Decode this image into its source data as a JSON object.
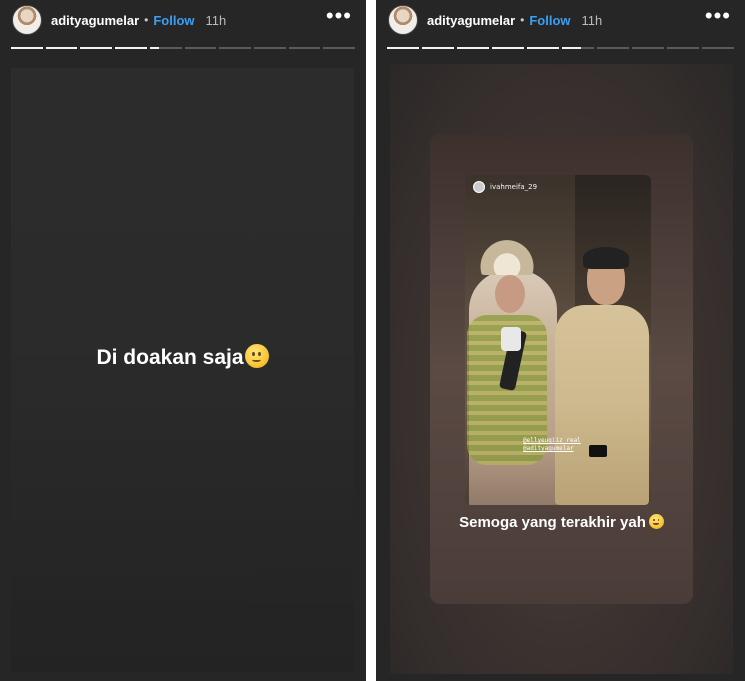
{
  "stories": [
    {
      "header": {
        "username": "adityagumelar",
        "follow_label": "Follow",
        "time": "11h",
        "more_glyph": "•••",
        "avatar_icon": "profile-avatar"
      },
      "progress": {
        "segments": 10,
        "completed": 4,
        "current_progress": 0.3
      },
      "caption": "Di doakan saja",
      "caption_emoji": "slightly-smiling-face-emoji"
    },
    {
      "header": {
        "username": "adityagumelar",
        "follow_label": "Follow",
        "time": "11h",
        "more_glyph": "•••",
        "avatar_icon": "profile-avatar"
      },
      "progress": {
        "segments": 10,
        "completed": 5,
        "current_progress": 0.6
      },
      "repost": {
        "source_account": "ivahmeifa_29",
        "mentions": [
          "@ellyeugiiz_real",
          "@adityagumelar"
        ]
      },
      "caption": "Semoga yang terakhir yah",
      "caption_emoji": "slightly-smiling-face-emoji"
    }
  ],
  "colors": {
    "follow": "#3aa0f5",
    "background": "#262626",
    "progress_done": "#f2f2f2",
    "progress_todo": "#5a5a5a"
  }
}
